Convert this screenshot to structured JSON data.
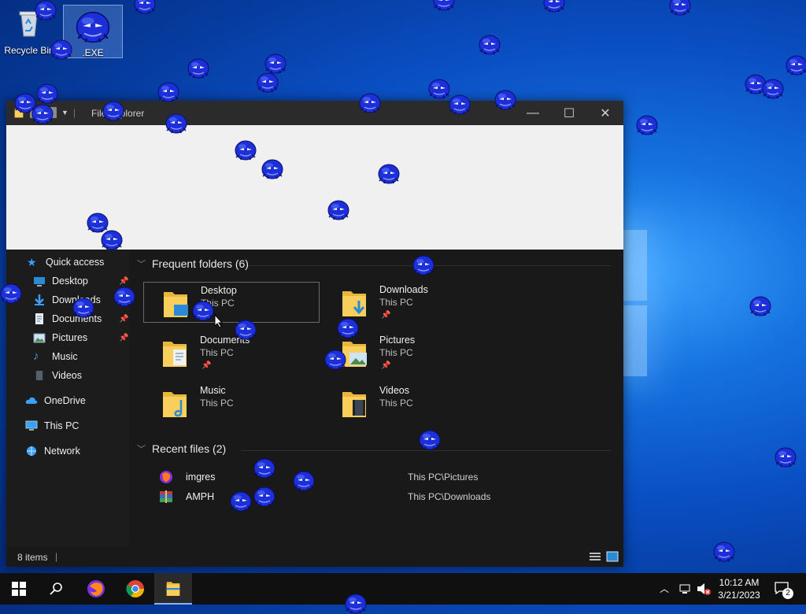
{
  "desktop": {
    "icons": [
      {
        "label": "Recycle Bin"
      },
      {
        "label": ".EXE"
      }
    ]
  },
  "window": {
    "title": "File Explorer",
    "controls": {
      "minimize": "—",
      "maximize": "☐",
      "close": "✕"
    },
    "nav": {
      "quick_access": "Quick access",
      "items": [
        {
          "label": "Desktop",
          "pinned": true
        },
        {
          "label": "Downloads",
          "pinned": true
        },
        {
          "label": "Documents",
          "pinned": true
        },
        {
          "label": "Pictures",
          "pinned": true
        },
        {
          "label": "Music",
          "pinned": false
        },
        {
          "label": "Videos",
          "pinned": false
        }
      ],
      "onedrive": "OneDrive",
      "this_pc": "This PC",
      "network": "Network"
    },
    "frequent": {
      "header": "Frequent folders (6)",
      "folders": [
        {
          "name": "Desktop",
          "location": "This PC",
          "pinned": false
        },
        {
          "name": "Downloads",
          "location": "This PC",
          "pinned": true
        },
        {
          "name": "Documents",
          "location": "This PC",
          "pinned": true
        },
        {
          "name": "Pictures",
          "location": "This PC",
          "pinned": true
        },
        {
          "name": "Music",
          "location": "This PC",
          "pinned": false
        },
        {
          "name": "Videos",
          "location": "This PC",
          "pinned": false
        }
      ]
    },
    "recent": {
      "header": "Recent files (2)",
      "files": [
        {
          "name": "imgres",
          "path": "This PC\\Pictures"
        },
        {
          "name": "AMPH",
          "path": "This PC\\Downloads"
        }
      ]
    },
    "status": {
      "items": "8 items"
    }
  },
  "taskbar": {
    "time": "10:12 AM",
    "date": "3/21/2023",
    "notification_count": "2"
  },
  "colors": {
    "accent": "#0078d7",
    "folder": "#f5c542",
    "creature": "#1a2fd6"
  }
}
